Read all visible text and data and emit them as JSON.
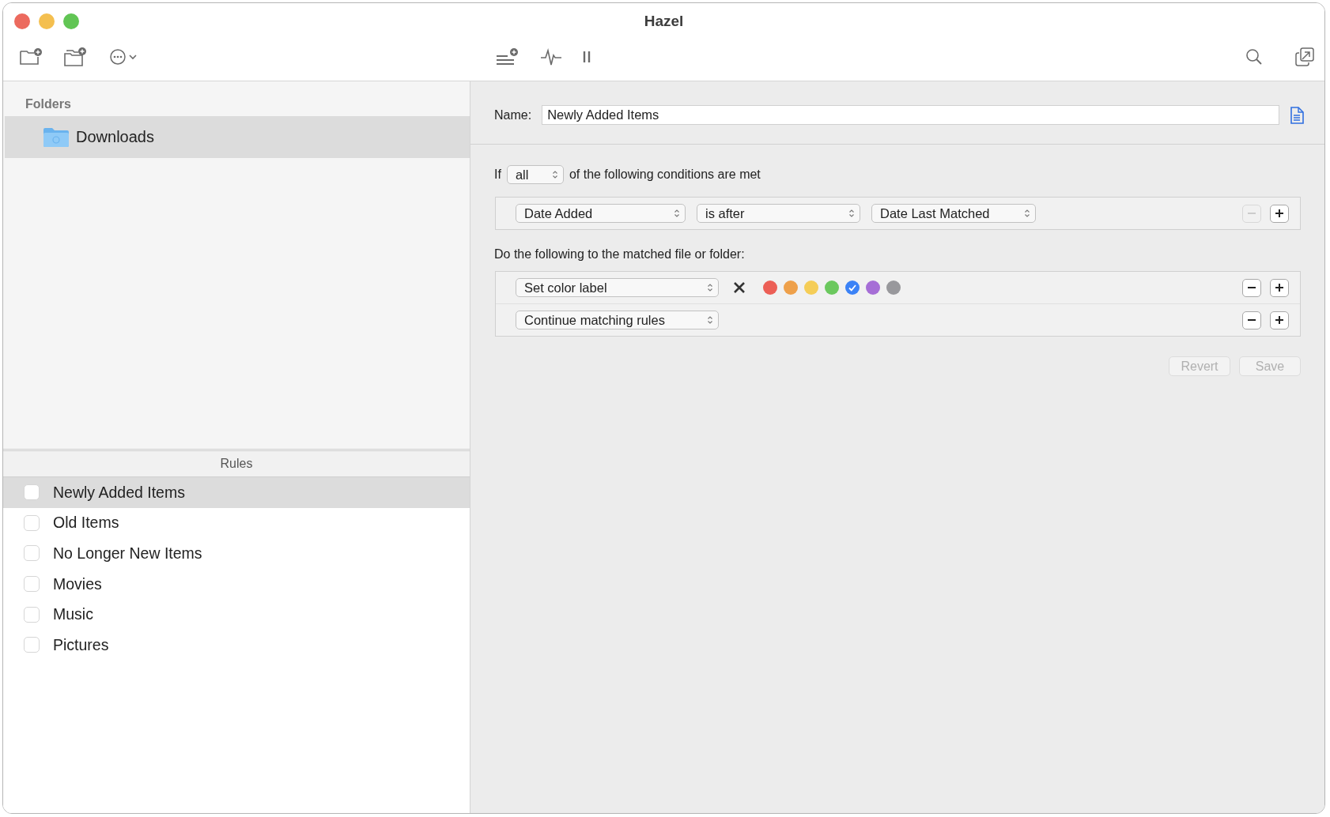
{
  "window": {
    "title": "Hazel"
  },
  "sidebar": {
    "folders_header": "Folders",
    "folders": [
      {
        "name": "Downloads",
        "selected": true
      }
    ],
    "rules_header": "Rules",
    "rules": [
      {
        "name": "Newly Added Items",
        "selected": true,
        "checked": false
      },
      {
        "name": "Old Items",
        "selected": false,
        "checked": false
      },
      {
        "name": "No Longer New Items",
        "selected": false,
        "checked": false
      },
      {
        "name": "Movies",
        "selected": false,
        "checked": false
      },
      {
        "name": "Music",
        "selected": false,
        "checked": false
      },
      {
        "name": "Pictures",
        "selected": false,
        "checked": false
      }
    ]
  },
  "rule_editor": {
    "name_label": "Name:",
    "name_value": "Newly Added Items",
    "condition_prefix": "If",
    "match_mode": "all",
    "condition_suffix": "of the following conditions are met",
    "conditions": [
      {
        "fields": [
          "Date Added",
          "is after",
          "Date Last Matched"
        ],
        "remove_disabled": true
      }
    ],
    "actions_label": "Do the following to the matched file or folder:",
    "actions": [
      {
        "kind": "color_label",
        "action": "Set color label",
        "colors": [
          {
            "color": "#ec5f56",
            "selected": false
          },
          {
            "color": "#eea04a",
            "selected": false
          },
          {
            "color": "#f5cd57",
            "selected": false
          },
          {
            "color": "#6bc85e",
            "selected": false
          },
          {
            "color": "#3b82f6",
            "selected": true
          },
          {
            "color": "#a66ed6",
            "selected": false
          },
          {
            "color": "#98989c",
            "selected": false
          }
        ]
      },
      {
        "kind": "plain",
        "action": "Continue matching rules"
      }
    ],
    "buttons": [
      {
        "label": "Revert",
        "disabled": true
      },
      {
        "label": "Save",
        "disabled": true
      }
    ]
  }
}
